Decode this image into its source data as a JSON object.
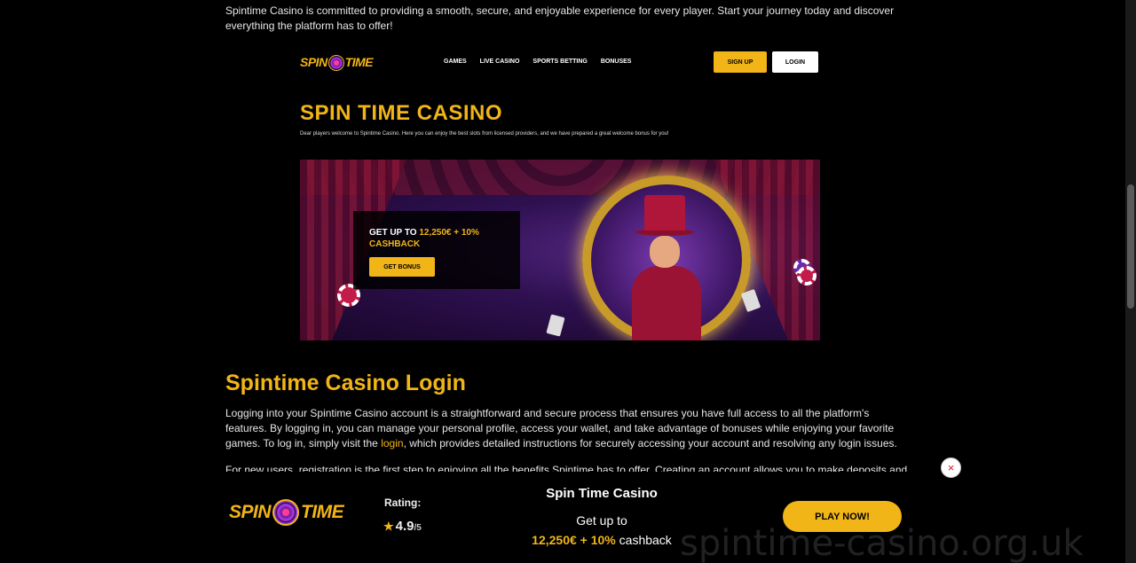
{
  "intro": "Spintime Casino is committed to providing a smooth, secure, and enjoyable experience for every player. Start your journey today and discover everything the platform has to offer!",
  "shot": {
    "logo_left": "SPIN",
    "logo_right": "TIME",
    "nav": [
      "GAMES",
      "LIVE CASINO",
      "SPORTS BETTING",
      "BONUSES"
    ],
    "signup": "SIGN UP",
    "login": "LOGIN",
    "title": "SPIN TIME CASINO",
    "subtitle": "Dear players welcome to Spintime Casino. Here you can enjoy the best slots from licensed providers, and we have prepared a great welcome bonus for you!",
    "promo_prefix": "GET UP TO",
    "promo_amount": "12,250€ + 10%",
    "promo_suffix": "CASHBACK",
    "promo_button": "GET BONUS"
  },
  "section": {
    "heading": "Spintime Casino Login",
    "para_before_link": "Logging into your Spintime Casino account is a straightforward and secure process that ensures you have full access to all the platform's features. By logging in, you can manage your personal profile, access your wallet, and take advantage of bonuses while enjoying your favorite games. To log in, simply visit the",
    "link": "login",
    "para_after_link": ", which provides detailed instructions for securely accessing your account and resolving any login issues.",
    "faded": "For new users, registration is the first step to enjoying all the benefits Spintime has to offer. Creating an account allows you to make deposits and withdrawals"
  },
  "sticky": {
    "logo_left": "SPIN",
    "logo_right": "TIME",
    "rating_label": "Rating:",
    "rating_value": "4.9",
    "rating_of": "/5",
    "title": "Spin Time Casino",
    "get": "Get up to",
    "offer_amount": "12,250€ + 10%",
    "offer_suffix": " cashback",
    "play": "PLAY NOW!",
    "close": "×"
  },
  "watermark": "spintime-casino.org.uk",
  "colors": {
    "accent": "#f2b517",
    "background": "#000000"
  }
}
